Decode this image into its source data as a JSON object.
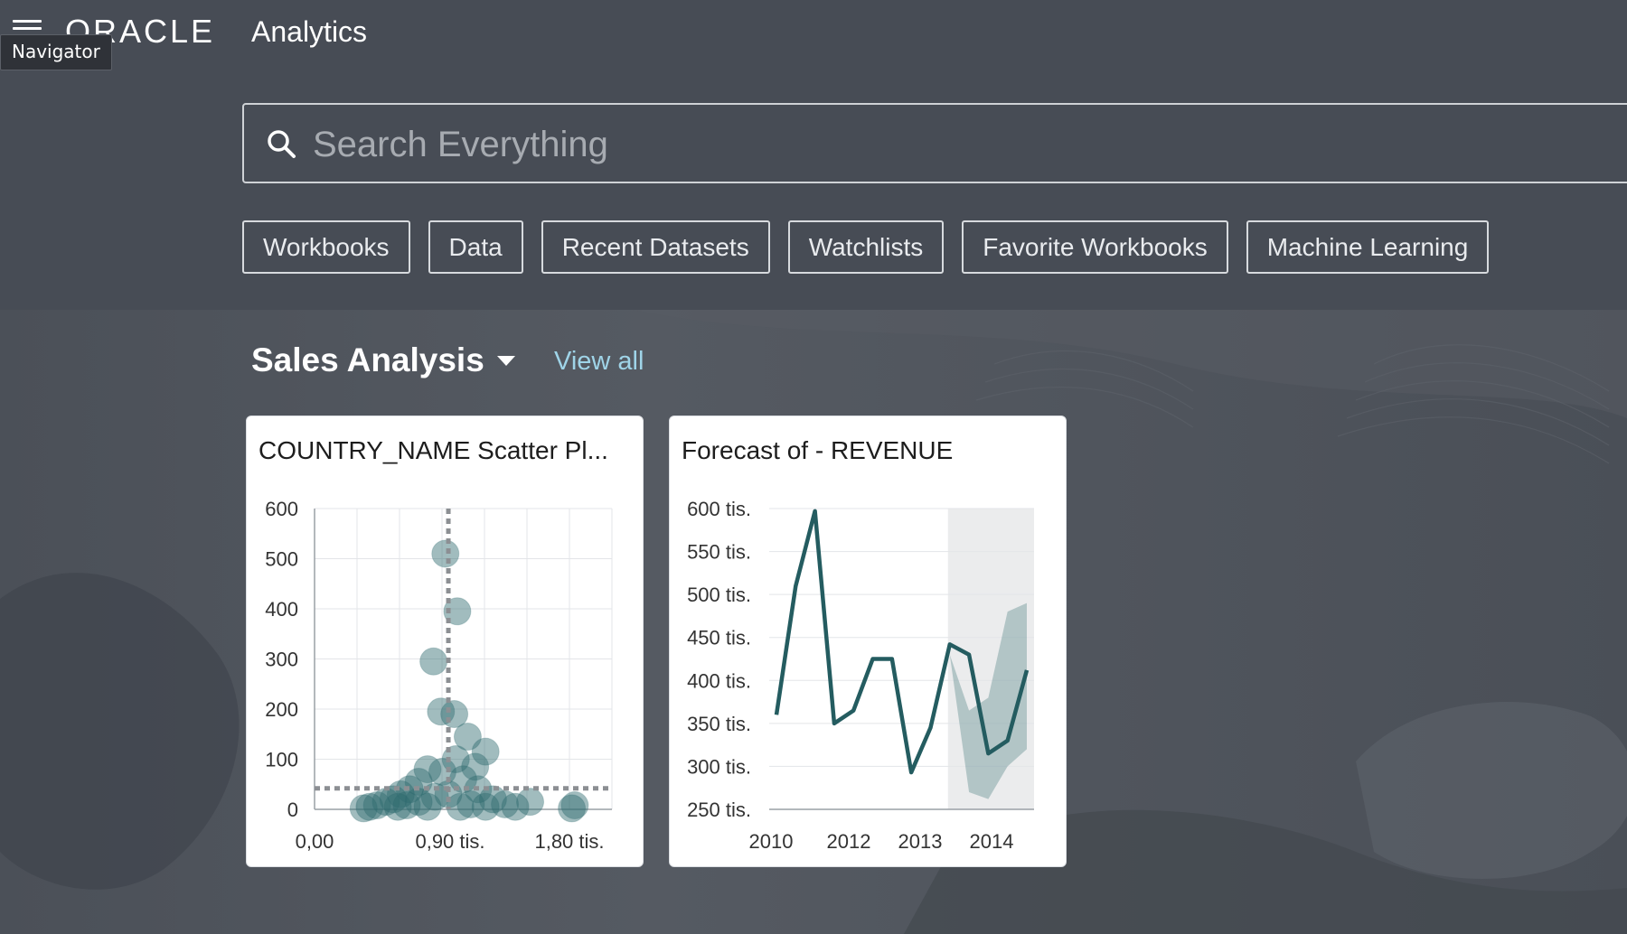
{
  "header": {
    "tooltip": "Navigator",
    "brand_logo": "ORACLE",
    "brand_name": "Analytics"
  },
  "search": {
    "placeholder": "Search Everything"
  },
  "filters": [
    "Workbooks",
    "Data",
    "Recent Datasets",
    "Watchlists",
    "Favorite Workbooks",
    "Machine Learning"
  ],
  "section": {
    "title": "Sales Analysis",
    "view_all": "View all"
  },
  "cards": [
    {
      "title": "COUNTRY_NAME Scatter Pl..."
    },
    {
      "title": "Forecast of - REVENUE"
    }
  ],
  "chart_data": [
    {
      "type": "scatter",
      "title": "COUNTRY_NAME Scatter Pl...",
      "y_ticks": [
        "600",
        "500",
        "400",
        "300",
        "200",
        "100",
        "0"
      ],
      "x_ticks": [
        "0,00",
        "0,90 tis.",
        "1,80 tis."
      ],
      "xlim": [
        0,
        2000
      ],
      "ylim": [
        0,
        600
      ],
      "grid": true,
      "reference_lines": {
        "x": 900,
        "y": 42
      },
      "points": [
        {
          "x": 880,
          "y": 510
        },
        {
          "x": 960,
          "y": 395
        },
        {
          "x": 800,
          "y": 295
        },
        {
          "x": 850,
          "y": 195
        },
        {
          "x": 940,
          "y": 190
        },
        {
          "x": 1030,
          "y": 145
        },
        {
          "x": 1150,
          "y": 115
        },
        {
          "x": 1080,
          "y": 85
        },
        {
          "x": 950,
          "y": 100
        },
        {
          "x": 860,
          "y": 75
        },
        {
          "x": 760,
          "y": 80
        },
        {
          "x": 700,
          "y": 55
        },
        {
          "x": 640,
          "y": 40
        },
        {
          "x": 580,
          "y": 30
        },
        {
          "x": 530,
          "y": 20
        },
        {
          "x": 480,
          "y": 15
        },
        {
          "x": 420,
          "y": 8
        },
        {
          "x": 370,
          "y": 5
        },
        {
          "x": 330,
          "y": 2
        },
        {
          "x": 1000,
          "y": 60
        },
        {
          "x": 1100,
          "y": 40
        },
        {
          "x": 1200,
          "y": 20
        },
        {
          "x": 1280,
          "y": 10
        },
        {
          "x": 1350,
          "y": 5
        },
        {
          "x": 1450,
          "y": 15
        },
        {
          "x": 1750,
          "y": 8
        },
        {
          "x": 1730,
          "y": 2
        },
        {
          "x": 900,
          "y": 30
        },
        {
          "x": 810,
          "y": 25
        },
        {
          "x": 700,
          "y": 15
        },
        {
          "x": 620,
          "y": 8
        },
        {
          "x": 560,
          "y": 5
        },
        {
          "x": 1050,
          "y": 10
        },
        {
          "x": 1150,
          "y": 5
        },
        {
          "x": 980,
          "y": 5
        },
        {
          "x": 760,
          "y": 5
        }
      ]
    },
    {
      "type": "line",
      "title": "Forecast of - REVENUE",
      "y_ticks": [
        "600 tis.",
        "550 tis.",
        "500 tis.",
        "450 tis.",
        "400 tis.",
        "350 tis.",
        "300 tis.",
        "250 tis."
      ],
      "x_ticks": [
        "2010",
        "2012",
        "2013",
        "2014"
      ],
      "ylim": [
        250000,
        600000
      ],
      "series": [
        {
          "values": [
            360000,
            510000,
            597000,
            350000,
            365000,
            425000,
            425000,
            293000,
            345000,
            442000,
            430000,
            315000,
            330000,
            412000
          ]
        }
      ],
      "forecast_band": {
        "upper": [
          430000,
          365000,
          380000,
          480000,
          490000
        ],
        "lower": [
          430000,
          270000,
          262000,
          300000,
          320000
        ]
      },
      "grid": true
    }
  ]
}
